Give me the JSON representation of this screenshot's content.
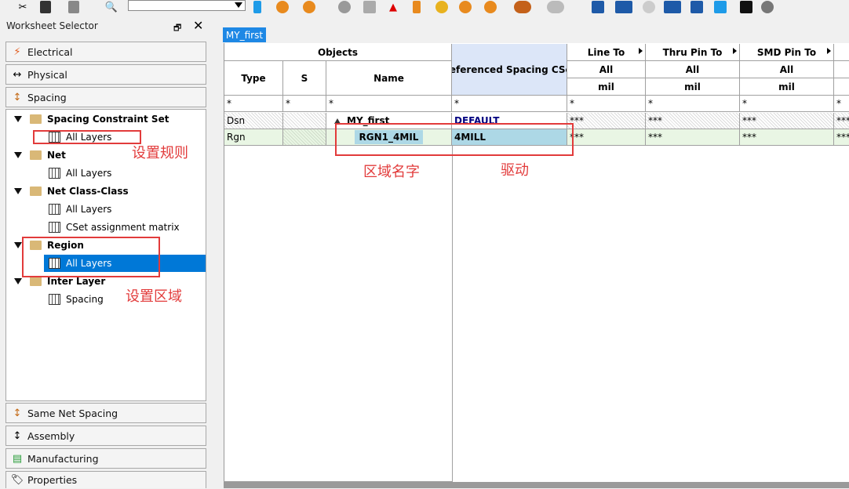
{
  "toolbar": {
    "combo_value": "",
    "icons": [
      "scissors-icon",
      "paste-icon",
      "copy-icon",
      "zoom-icon",
      "bookmark-icon",
      "nav-next-icon",
      "nav-prev-icon",
      "undo-icon",
      "lock-icon",
      "warning-icon",
      "pin-icon",
      "sun-icon",
      "list-icon",
      "table-icon",
      "redo-icon",
      "redo2-icon",
      "component-icon",
      "toggle-icon",
      "eye-icon",
      "toggle2-icon",
      "color-icon",
      "bright-icon",
      "chart-icon",
      "search-icon"
    ]
  },
  "worksheet_selector": {
    "title": "Worksheet Selector",
    "categories_top": [
      {
        "label": "Electrical",
        "icon": "lightning-icon"
      },
      {
        "label": "Physical",
        "icon": "physical-icon"
      },
      {
        "label": "Spacing",
        "icon": "spacing-icon"
      }
    ],
    "tree": [
      {
        "label": "Spacing Constraint Set",
        "type": "folder"
      },
      {
        "label": "All Layers",
        "type": "sheet"
      },
      {
        "label": "Net",
        "type": "folder"
      },
      {
        "label": "All Layers",
        "type": "sheet"
      },
      {
        "label": "Net Class-Class",
        "type": "folder"
      },
      {
        "label": "All Layers",
        "type": "sheet"
      },
      {
        "label": "CSet assignment matrix",
        "type": "sheet"
      },
      {
        "label": "Region",
        "type": "folder"
      },
      {
        "label": "All Layers",
        "type": "sheet",
        "selected": true
      },
      {
        "label": "Inter Layer",
        "type": "folder"
      },
      {
        "label": "Spacing",
        "type": "sheet"
      }
    ],
    "categories_bottom": [
      {
        "label": "Same Net Spacing",
        "icon": "same-net-icon"
      },
      {
        "label": "Assembly",
        "icon": "assembly-icon"
      },
      {
        "label": "Manufacturing",
        "icon": "manufacturing-icon"
      },
      {
        "label": "Properties",
        "icon": "tag-icon"
      }
    ]
  },
  "tab": {
    "label": "MY_first"
  },
  "grid": {
    "objects_header": "Objects",
    "col_type": "Type",
    "col_s": "S",
    "col_name": "Name",
    "col_ref": "Referenced Spacing CSet",
    "cols": [
      {
        "label": "Line To",
        "sub": "All",
        "unit": "mil"
      },
      {
        "label": "Thru Pin To",
        "sub": "All",
        "unit": "mil"
      },
      {
        "label": "SMD Pin To",
        "sub": "All",
        "unit": "mil"
      }
    ],
    "filter": "*",
    "rows": [
      {
        "type": "Dsn",
        "s": "",
        "name": "MY_first",
        "ref": "DEFAULT",
        "vals": [
          "***",
          "***",
          "***",
          "***"
        ]
      },
      {
        "type": "Rgn",
        "s": "",
        "name": "RGN1_4MIL",
        "ref": "4MILL",
        "vals": [
          "***",
          "***",
          "***",
          "***"
        ]
      }
    ]
  },
  "annotations": {
    "rules": "设置规则",
    "region": "设置区域",
    "region_name": "区域名字",
    "drive": "驱动"
  }
}
